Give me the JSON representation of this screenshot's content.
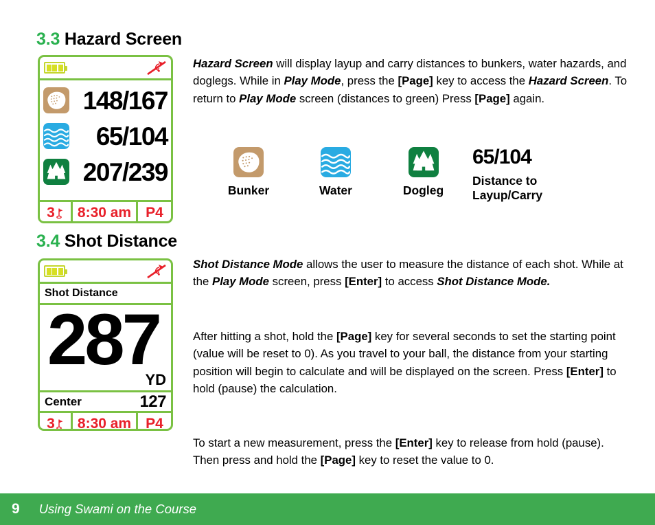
{
  "sections": {
    "hazard": {
      "number": "3.3",
      "title": "Hazard Screen",
      "paragraph_html": "<i class=\"bi\">Hazard Screen</i> will display layup and carry distances to bunkers, water hazards, and doglegs. While in <i class=\"bi\">Play Mode</i>, press the <b>[Page]</b> key to access the <i class=\"bi\">Hazard Screen</i>. To return to <i class=\"bi\">Play Mode</i> screen (distances to green) Press <b>[Page]</b> again."
    },
    "shot": {
      "number": "3.4",
      "title": "Shot Distance",
      "paragraph1_html": "<i class=\"bi\">Shot Distance Mode</i> allows the user to measure the distance of each shot. While at the <i class=\"bi\">Play Mode</i> screen, press <b>[Enter]</b> to access <i class=\"bi\">Shot Distance Mode.</i>",
      "paragraph2_html": "After hitting a shot, hold the <b>[Page]</b> key for several seconds to set the starting point (value will be reset to 0). As you travel to your ball, the distance from your starting position will begin to calculate and will be displayed on the screen. Press <b>[Enter]</b> to hold (pause) the calculation.",
      "paragraph3_html": "To start a new measurement, press the <b>[Enter]</b> key to release from hold (pause). Then press and hold the <b>[Page]</b> key to reset the value to 0."
    }
  },
  "hazard_device": {
    "status": {
      "battery_icon": "battery-icon",
      "battery_bars": 3,
      "gps_icon": "satellite-icon"
    },
    "rows": [
      {
        "icon": "bunker-icon",
        "value": "148/167"
      },
      {
        "icon": "water-icon",
        "value": "65/104"
      },
      {
        "icon": "dogleg-icon",
        "value": "207/239"
      }
    ],
    "bottom": {
      "hole": "3",
      "hole_icon": "flag-icon",
      "time": "8:30 am",
      "par": "P4"
    }
  },
  "shot_device": {
    "status": {
      "battery_icon": "battery-icon",
      "battery_bars": 3,
      "gps_icon": "satellite-icon"
    },
    "title": "Shot Distance",
    "distance": "287",
    "units": "YD",
    "center_label": "Center",
    "center_value": "127",
    "bottom": {
      "hole": "3",
      "hole_icon": "flag-icon",
      "time": "8:30 am",
      "par": "P4"
    }
  },
  "legend": {
    "items": [
      {
        "icon": "bunker-icon",
        "label": "Bunker"
      },
      {
        "icon": "water-icon",
        "label": "Water"
      },
      {
        "icon": "dogleg-icon",
        "label": "Dogleg"
      }
    ],
    "distance": {
      "value": "65/104",
      "caption": "Distance to\nLayup/Carry"
    }
  },
  "footer": {
    "page_number": "9",
    "text": "Using Swami on the Course"
  },
  "colors": {
    "heading_green": "#2ab14f",
    "device_border": "#7ac143",
    "footer_green": "#3faa50",
    "status_red": "#e8202a",
    "bunker_tan": "#c39a6b",
    "water_blue": "#29abe2",
    "dogleg_green": "#0f8040",
    "battery_yellow": "#d7df23"
  }
}
